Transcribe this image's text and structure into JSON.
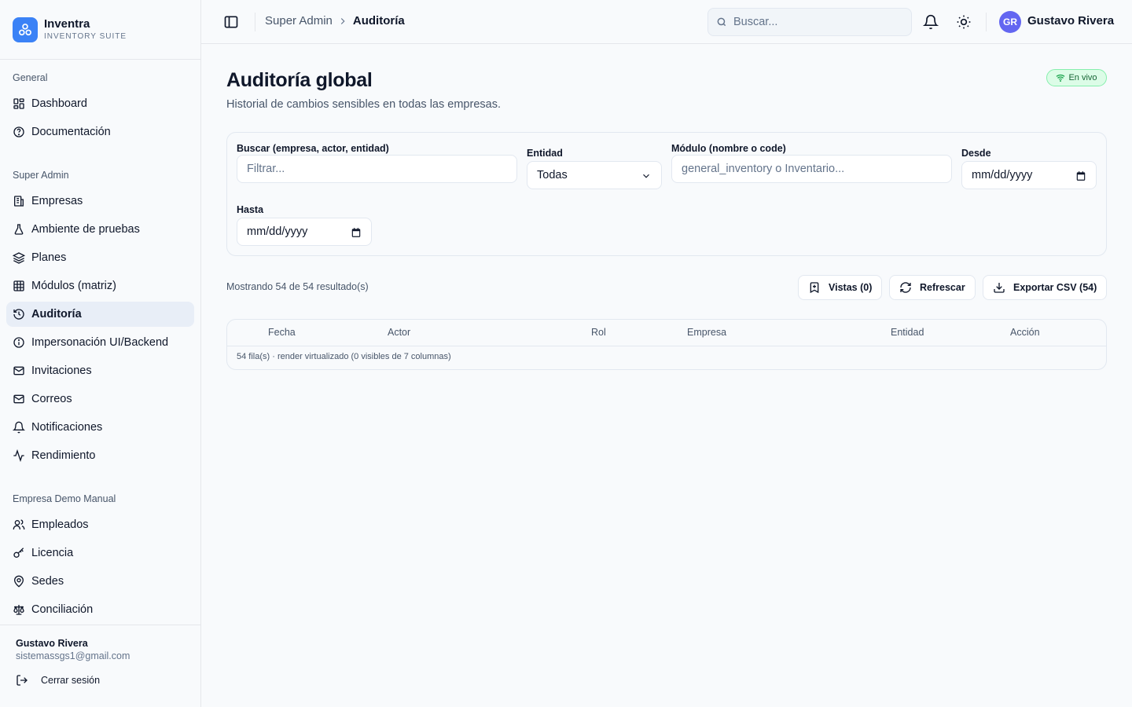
{
  "brand": {
    "name": "Inventra",
    "subtitle": "INVENTORY SUITE"
  },
  "sidebar": {
    "sections": [
      {
        "label": "General",
        "items": [
          {
            "label": "Dashboard",
            "icon": "dashboard-icon"
          },
          {
            "label": "Documentación",
            "icon": "help-circle-icon"
          }
        ]
      },
      {
        "label": "Super Admin",
        "items": [
          {
            "label": "Empresas",
            "icon": "building-icon"
          },
          {
            "label": "Ambiente de pruebas",
            "icon": "flask-icon"
          },
          {
            "label": "Planes",
            "icon": "layers-icon"
          },
          {
            "label": "Módulos (matriz)",
            "icon": "grid-icon"
          },
          {
            "label": "Auditoría",
            "icon": "history-icon",
            "active": true
          },
          {
            "label": "Impersonación UI/Backend",
            "icon": "info-icon"
          },
          {
            "label": "Invitaciones",
            "icon": "mail-icon"
          },
          {
            "label": "Correos",
            "icon": "mail-icon"
          },
          {
            "label": "Notificaciones",
            "icon": "bell-icon"
          },
          {
            "label": "Rendimiento",
            "icon": "activity-icon"
          }
        ]
      },
      {
        "label": "Empresa Demo Manual",
        "items": [
          {
            "label": "Empleados",
            "icon": "users-icon"
          },
          {
            "label": "Licencia",
            "icon": "key-icon"
          },
          {
            "label": "Sedes",
            "icon": "map-pin-icon"
          },
          {
            "label": "Conciliación",
            "icon": "scale-icon"
          }
        ]
      }
    ],
    "footer": {
      "name": "Gustavo Rivera",
      "email": "sistemassgs1@gmail.com",
      "logout": "Cerrar sesión"
    }
  },
  "header": {
    "breadcrumb": [
      "Super Admin",
      "Auditoría"
    ],
    "search_placeholder": "Buscar...",
    "user": {
      "initials": "GR",
      "name": "Gustavo Rivera"
    }
  },
  "page": {
    "title": "Auditoría global",
    "subtitle": "Historial de cambios sensibles en todas las empresas.",
    "live_badge": "En vivo"
  },
  "filters": {
    "search": {
      "label": "Buscar (empresa, actor, entidad)",
      "placeholder": "Filtrar..."
    },
    "entity": {
      "label": "Entidad",
      "value": "Todas"
    },
    "module": {
      "label": "Módulo (nombre o code)",
      "placeholder": "general_inventory o Inventario..."
    },
    "from": {
      "label": "Desde",
      "value": "mm/dd/yyyy"
    },
    "to": {
      "label": "Hasta",
      "value": "mm/dd/yyyy"
    }
  },
  "results": {
    "summary": "Mostrando 54 de 54 resultado(s)",
    "views_button": "Vistas (0)",
    "refresh_button": "Refrescar",
    "export_button": "Exportar CSV (54)"
  },
  "table": {
    "columns": [
      "Fecha",
      "Actor",
      "Rol",
      "Empresa",
      "Entidad",
      "Acción"
    ],
    "footer": "54 fila(s) · render virtualizado (0 visibles de 7 columnas)"
  },
  "colors": {
    "accent": "#3b82f6",
    "active_bg": "#e8eef7",
    "live_green": "#16a34a",
    "avatar": "#6366f1"
  }
}
